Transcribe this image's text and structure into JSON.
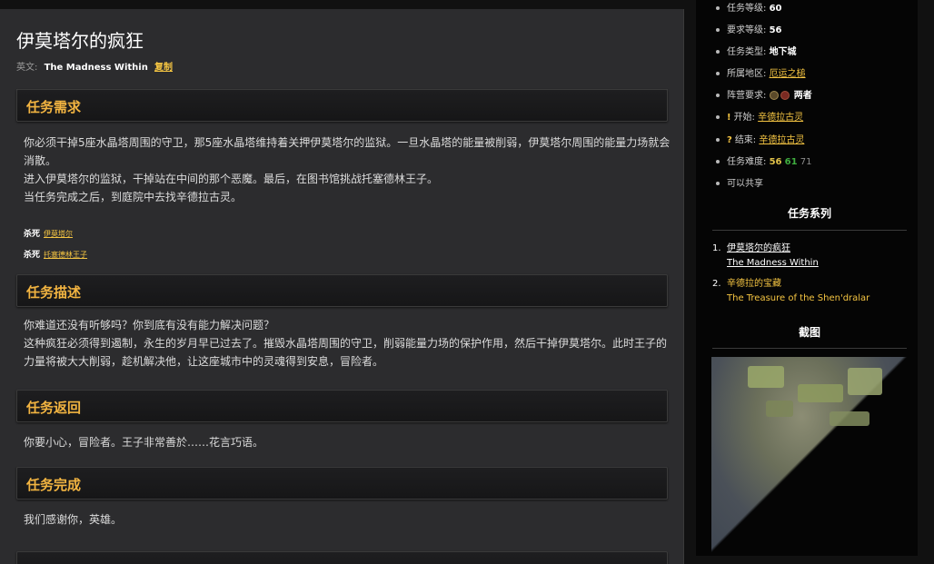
{
  "quest": {
    "title": "伊莫塔尔的疯狂",
    "en_label": "英文:",
    "en_name": "The Madness Within",
    "copy_label": "复制"
  },
  "sections": {
    "requirements": {
      "heading": "任务需求",
      "lines": [
        "你必须干掉5座水晶塔周围的守卫，那5座水晶塔维持着关押伊莫塔尔的监狱。一旦水晶塔的能量被削弱，伊莫塔尔周围的能量力场就会",
        "消散。",
        "进入伊莫塔尔的监狱，干掉站在中间的那个恶魔。最后，在图书馆挑战托塞德林王子。",
        "当任务完成之后，到庭院中去找辛德拉古灵。"
      ],
      "kills": [
        {
          "label": "杀死",
          "target": "伊莫塔尔"
        },
        {
          "label": "杀死",
          "target": "托塞德林王子"
        }
      ]
    },
    "description": {
      "heading": "任务描述",
      "lines": [
        "你难道还没有听够吗？你到底有没有能力解决问题？",
        "这种疯狂必须得到遏制，永生的岁月早已过去了。摧毁水晶塔周围的守卫，削弱能量力场的保护作用，然后干掉伊莫塔尔。此时王子的",
        "力量将被大大削弱，趁机解决他，让这座城市中的灵魂得到安息，冒险者。"
      ]
    },
    "return": {
      "heading": "任务返回",
      "lines": [
        "你要小心，冒险者。王子非常善於……花言巧语。"
      ]
    },
    "complete": {
      "heading": "任务完成",
      "lines": [
        "我们感谢你，英雄。"
      ]
    }
  },
  "sidebar": {
    "info": [
      {
        "label": "任务等级:",
        "value": "60"
      },
      {
        "label": "要求等级:",
        "value": "56"
      },
      {
        "label": "任务类型:",
        "value": "地下城"
      },
      {
        "label": "所属地区:",
        "link": "厄运之槌"
      },
      {
        "label": "阵营要求:",
        "value": "两者"
      },
      {
        "icon": "!",
        "label": "开始:",
        "link": "辛德拉古灵"
      },
      {
        "icon": "?",
        "label": "结束:",
        "link": "辛德拉古灵"
      },
      {
        "label": "任务难度:",
        "d1": "56",
        "d2": "61",
        "d3": "71"
      },
      {
        "label": "可以共享"
      }
    ],
    "series_heading": "任务系列",
    "series": [
      {
        "num": "1.",
        "cn": "伊莫塔尔的疯狂",
        "en": "The Madness Within"
      },
      {
        "num": "2.",
        "cn": "辛德拉的宝藏",
        "en": "The Treasure of the Shen'dralar"
      }
    ],
    "screenshot_heading": "截图"
  },
  "colors": {
    "accent": "#f2b441",
    "link": "#f5c542",
    "panel": "#2c2c2e",
    "sidebar": "#050505",
    "alliance": "#5b4a2a",
    "horde": "#7a2a22"
  }
}
